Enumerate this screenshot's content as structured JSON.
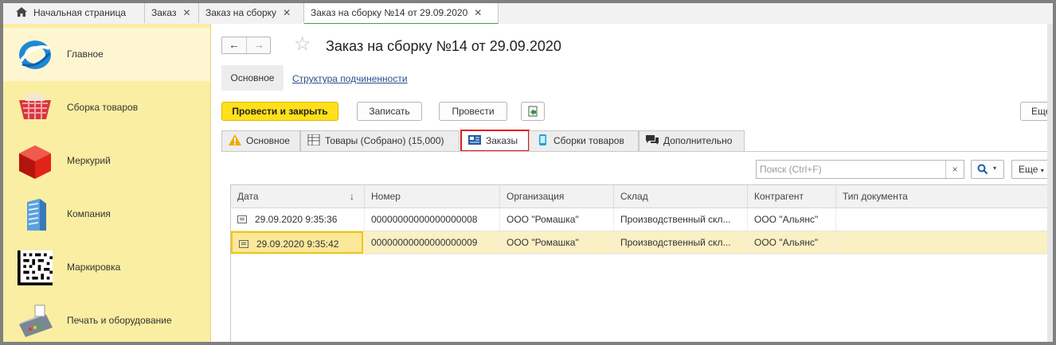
{
  "top_tabs": [
    {
      "label": "Начальная страница",
      "closable": false
    },
    {
      "label": "Заказ",
      "closable": true
    },
    {
      "label": "Заказ на сборку",
      "closable": true
    },
    {
      "label": "Заказ на сборку №14 от 29.09.2020",
      "closable": true,
      "active": true
    }
  ],
  "close_glyph": "✕",
  "sidebar": {
    "items": [
      {
        "label": "Главное",
        "icon": "main-logo-icon",
        "selected": true
      },
      {
        "label": "Сборка товаров",
        "icon": "basket-icon"
      },
      {
        "label": "Меркурий",
        "icon": "cube-icon"
      },
      {
        "label": "Компания",
        "icon": "building-icon"
      },
      {
        "label": "Маркировка",
        "icon": "datamatrix-icon"
      },
      {
        "label": "Печать и оборудование",
        "icon": "pos-terminal-icon"
      }
    ]
  },
  "document": {
    "title": "Заказ на сборку №14 от 29.09.2020",
    "section_main": "Основное",
    "section_link": "Структура подчиненности"
  },
  "toolbar": {
    "post_close": "Провести и закрыть",
    "save": "Записать",
    "post": "Провести",
    "more": "Еще"
  },
  "tabs": [
    {
      "label": "Основное",
      "icon": "warning-icon"
    },
    {
      "label": "Товары (Собрано) (15,000)",
      "icon": "table-icon"
    },
    {
      "label": "Заказы",
      "icon": "orders-icon",
      "active": true
    },
    {
      "label": "Сборки товаров",
      "icon": "phone-icon"
    },
    {
      "label": "Дополнительно",
      "icon": "chat-icon"
    }
  ],
  "list": {
    "search_placeholder": "Поиск (Ctrl+F)",
    "clear_glyph": "×",
    "more": "Еще",
    "columns": [
      "Дата",
      "Номер",
      "Организация",
      "Склад",
      "Контрагент",
      "Тип документа"
    ],
    "sort_glyph": "↓",
    "rows": [
      {
        "date": "29.09.2020 9:35:36",
        "number": "00000000000000000008",
        "org": "ООО \"Ромашка\"",
        "warehouse": "Производственный скл...",
        "counterparty": "ООО \"Альянс\"",
        "doc_type": ""
      },
      {
        "date": "29.09.2020 9:35:42",
        "number": "00000000000000000009",
        "org": "ООО \"Ромашка\"",
        "warehouse": "Производственный скл...",
        "counterparty": "ООО \"Альянс\"",
        "doc_type": "",
        "selected": true
      }
    ]
  },
  "colors": {
    "sidebar_bg": "#faeea2",
    "primary_button": "#ffe01a",
    "active_tab_border": "#e0161a",
    "active_toptab_underline": "#3aa14a",
    "selected_row": "#fbf0c4"
  }
}
